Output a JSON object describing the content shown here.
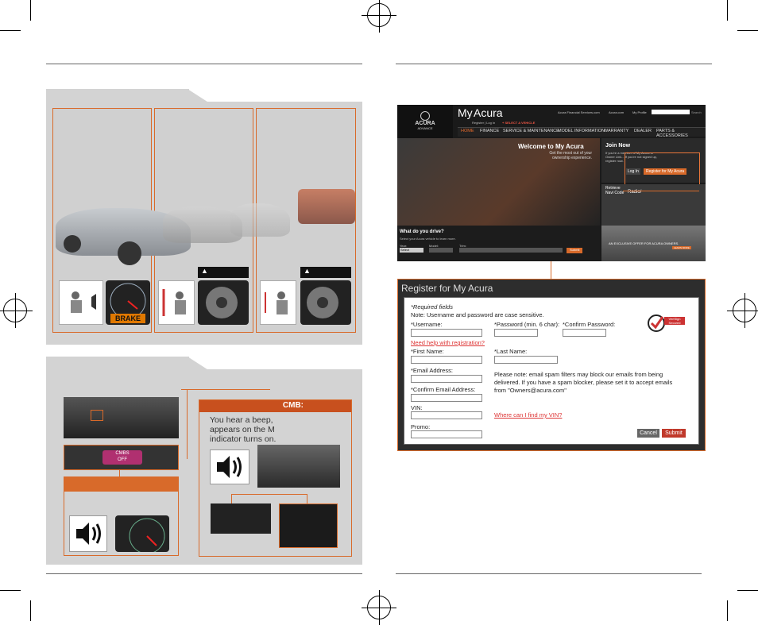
{
  "left": {
    "brake_label": "BRAKE",
    "cmbs_off_label": "CMBS\nOFF",
    "cmb_header": "CMB:",
    "cmb_text": "You hear a beep,\nappears on the M\nindicator turns on."
  },
  "website": {
    "brand_line1": "My",
    "brand_line2": "Acura",
    "logo_text": "ACURA",
    "logo_sub": "ADVANCE",
    "top_links": [
      "Acura Financial Services.com",
      "Acura.com",
      "My Profile",
      "Search"
    ],
    "sub_links": "Register | Log In",
    "select_vehicle": "+ SELECT A VEHICLE",
    "nav": [
      "HOME",
      "FINANCE",
      "SERVICE & MAINTENANCE",
      "MODEL INFORMATION",
      "WARRANTY",
      "DEALER",
      "PARTS & ACCESSORIES"
    ],
    "welcome_title": "Welcome to My Acura",
    "welcome_sub": "Get the most out of your\nownership experience.",
    "join_title": "Join Now",
    "join_text": "If you're a member of My Acura or\nOwner Link... If you're not signed up,\nregister now.",
    "login_btn": "Log In",
    "register_btn": "Register for My Acura",
    "retrieve": "Retrieve\nNavi Code",
    "radio": "Radio/",
    "what_drive": "What do you drive?",
    "select_text": "Select your Acura vehicle to learn more.",
    "year_label": "Year:",
    "model_label": "Model:",
    "trim_label": "Trim:",
    "select_value": "Select",
    "submit": "Submit",
    "offer": "AN EXCLUSIVE OFFER FOR ACURA OWNERS.",
    "learn_more": "LEARN MORE"
  },
  "form": {
    "title": "Register for My Acura",
    "required": "*Required fields",
    "note": "Note: Username and password are case sensitive.",
    "username": "*Username:",
    "password": "*Password (min. 6 char):",
    "confirm_password": "*Confirm Password:",
    "help_link": "Need help with registration?",
    "first_name": "*First Name:",
    "last_name": "*Last Name:",
    "email": "*Email Address:",
    "email_note": "Please note: email spam filters may block our emails from being\ndelivered. If you have a spam blocker, please set it to accept emails\nfrom \"Owners@acura.com\"",
    "confirm_email": "*Confirm Email Address:",
    "vin": "VIN:",
    "vin_link": "Where can I find my VIN?",
    "promo": "Promo:",
    "cancel": "Cancel",
    "submit": "Submit",
    "verisign": "VeriSign\nSecured"
  },
  "colors": {
    "accent_orange": "#d86a2a",
    "panel_grey": "#d3d3d3",
    "submit_red": "#c0392b"
  }
}
